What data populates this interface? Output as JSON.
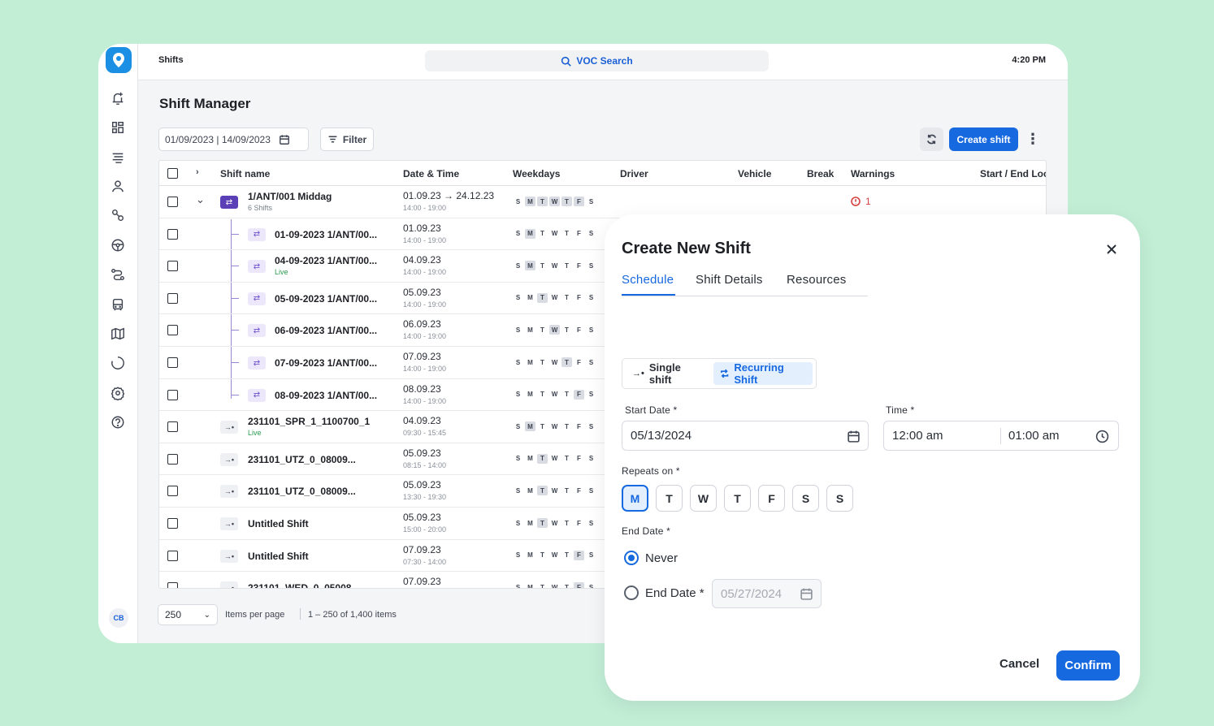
{
  "topbar": {
    "title": "Shifts",
    "search": "VOC Search",
    "clock": "4:20 PM"
  },
  "sidebar": {
    "icons": [
      "bell-plus-icon",
      "dashboard-icon",
      "list-icon",
      "user-icon",
      "route-icon",
      "steering-wheel-icon",
      "path-icon",
      "bus-icon",
      "map-icon",
      "loader-icon",
      "settings-icon",
      "help-icon"
    ],
    "avatar": "CB"
  },
  "page": {
    "title": "Shift Manager",
    "date_range": "01/09/2023 | 14/09/2023",
    "filter": "Filter",
    "create": "Create shift"
  },
  "table": {
    "columns": [
      "Shift name",
      "Date & Time",
      "Weekdays",
      "Driver",
      "Vehicle",
      "Break",
      "Warnings",
      "Start / End Loc"
    ],
    "weekday_letters": [
      "S",
      "M",
      "T",
      "W",
      "T",
      "F",
      "S"
    ],
    "rows": [
      {
        "type": "parent",
        "name": "1/ANT/001 Middag",
        "sub": "6 Shifts",
        "date": "01.09.23 → 24.12.23",
        "time": "14:00 - 19:00",
        "days": [
          1,
          2,
          3,
          4,
          5
        ],
        "warnings": "1"
      },
      {
        "type": "child",
        "name": "01-09-2023 1/ANT/00...",
        "sub": "",
        "date": "01.09.23",
        "time": "14:00 - 19:00",
        "days": [
          1
        ]
      },
      {
        "type": "child",
        "name": "04-09-2023 1/ANT/00...",
        "sub": "Live",
        "date": "04.09.23",
        "time": "14:00 - 19:00",
        "days": [
          1
        ]
      },
      {
        "type": "child",
        "name": "05-09-2023 1/ANT/00...",
        "sub": "",
        "date": "05.09.23",
        "time": "14:00 - 19:00",
        "days": [
          2
        ]
      },
      {
        "type": "child",
        "name": "06-09-2023 1/ANT/00...",
        "sub": "",
        "date": "06.09.23",
        "time": "14:00 - 19:00",
        "days": [
          3
        ]
      },
      {
        "type": "child",
        "name": "07-09-2023 1/ANT/00...",
        "sub": "",
        "date": "07.09.23",
        "time": "14:00 - 19:00",
        "days": [
          4
        ]
      },
      {
        "type": "child",
        "name": "08-09-2023 1/ANT/00...",
        "sub": "",
        "date": "08.09.23",
        "time": "14:00 - 19:00",
        "days": [
          5
        ]
      },
      {
        "type": "single",
        "name": "231101_SPR_1_1100700_1",
        "sub": "Live",
        "date": "04.09.23",
        "time": "09:30 - 15:45",
        "days": [
          1
        ]
      },
      {
        "type": "single",
        "name": "231101_UTZ_0_08009...",
        "sub": "",
        "date": "05.09.23",
        "time": "08:15 - 14:00",
        "days": [
          2
        ]
      },
      {
        "type": "single",
        "name": "231101_UTZ_0_08009...",
        "sub": "",
        "date": "05.09.23",
        "time": "13:30 - 19:30",
        "days": [
          2
        ]
      },
      {
        "type": "single",
        "name": "Untitled Shift",
        "sub": "",
        "date": "05.09.23",
        "time": "15:00 - 20:00",
        "days": [
          2
        ]
      },
      {
        "type": "single",
        "name": "Untitled Shift",
        "sub": "",
        "date": "07.09.23",
        "time": "07:30 - 14:00",
        "days": [
          5
        ]
      },
      {
        "type": "single",
        "name": "231101_WED_0_05008...",
        "sub": "",
        "date": "07.09.23",
        "time": "",
        "days": [
          5
        ]
      }
    ]
  },
  "pager": {
    "per_page": "250",
    "label": "Items per page",
    "count": "1 – 250 of 1,400 items"
  },
  "modal": {
    "title": "Create New Shift",
    "tabs": [
      "Schedule",
      "Shift Details",
      "Resources"
    ],
    "single": "Single shift",
    "recurring": "Recurring Shift",
    "start_date_label": "Start Date *",
    "start_date": "05/13/2024",
    "time_label": "Time *",
    "time_start": "12:00 am",
    "time_end": "01:00 am",
    "repeats_label": "Repeats on *",
    "repeat_days": [
      "M",
      "T",
      "W",
      "T",
      "F",
      "S",
      "S"
    ],
    "repeat_selected": [
      0
    ],
    "end_label": "End Date *",
    "never": "Never",
    "end_date_option": "End Date *",
    "end_date": "05/27/2024",
    "cancel": "Cancel",
    "confirm": "Confirm"
  },
  "colors": {
    "accent": "#1769e0",
    "background": "#c2eed6",
    "recurring": "#5a3fb7",
    "warning": "#d64040",
    "live": "#2a9b4d"
  }
}
